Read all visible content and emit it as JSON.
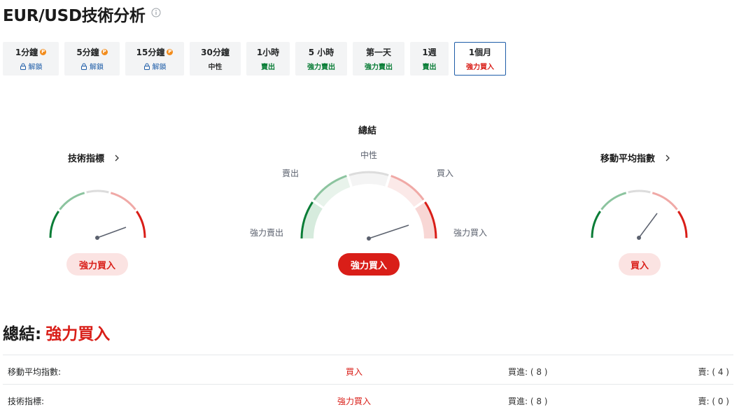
{
  "header": {
    "title": "EUR/USD技術分析",
    "info_icon": "info-icon"
  },
  "tabs": [
    {
      "label": "1分鐘",
      "value": "解鎖",
      "pro": true,
      "state": "unlock"
    },
    {
      "label": "5分鐘",
      "value": "解鎖",
      "pro": true,
      "state": "unlock"
    },
    {
      "label": "15分鐘",
      "value": "解鎖",
      "pro": true,
      "state": "unlock"
    },
    {
      "label": "30分鐘",
      "value": "中性",
      "state": "neutral"
    },
    {
      "label": "1小時",
      "value": "賣出",
      "state": "sell"
    },
    {
      "label": "5 小時",
      "value": "強力賣出",
      "state": "strong-sell"
    },
    {
      "label": "第一天",
      "value": "強力賣出",
      "state": "strong-sell"
    },
    {
      "label": "1週",
      "value": "賣出",
      "state": "sell"
    },
    {
      "label": "1個月",
      "value": "強力買入",
      "state": "strong-buy",
      "active": true
    }
  ],
  "gauges": {
    "technical": {
      "title": "技術指標",
      "result": "強力買入"
    },
    "summary": {
      "title": "總結",
      "labels": {
        "neutral": "中性",
        "sell": "賣出",
        "buy": "買入",
        "strong_sell": "強力賣出",
        "strong_buy": "強力買入"
      },
      "result": "強力買入"
    },
    "moving_averages": {
      "title": "移動平均指數",
      "result": "買入"
    }
  },
  "summary": {
    "prefix": "總結:",
    "value": "強力買入",
    "rows": [
      {
        "name": "移動平均指數:",
        "signal": "買入",
        "buy": "買進: ( 8 )",
        "sell": "賣: ( 4 )"
      },
      {
        "name": "技術指標:",
        "signal": "強力買入",
        "buy": "買進: ( 8 )",
        "sell": "賣: ( 0 )"
      }
    ]
  },
  "colors": {
    "strong_sell": "#0a7d37",
    "sell": "#8cc49f",
    "neutral": "#dcdcdc",
    "buy": "#f0a9a6",
    "strong_buy": "#d91e18",
    "accent": "#1e5da8"
  }
}
